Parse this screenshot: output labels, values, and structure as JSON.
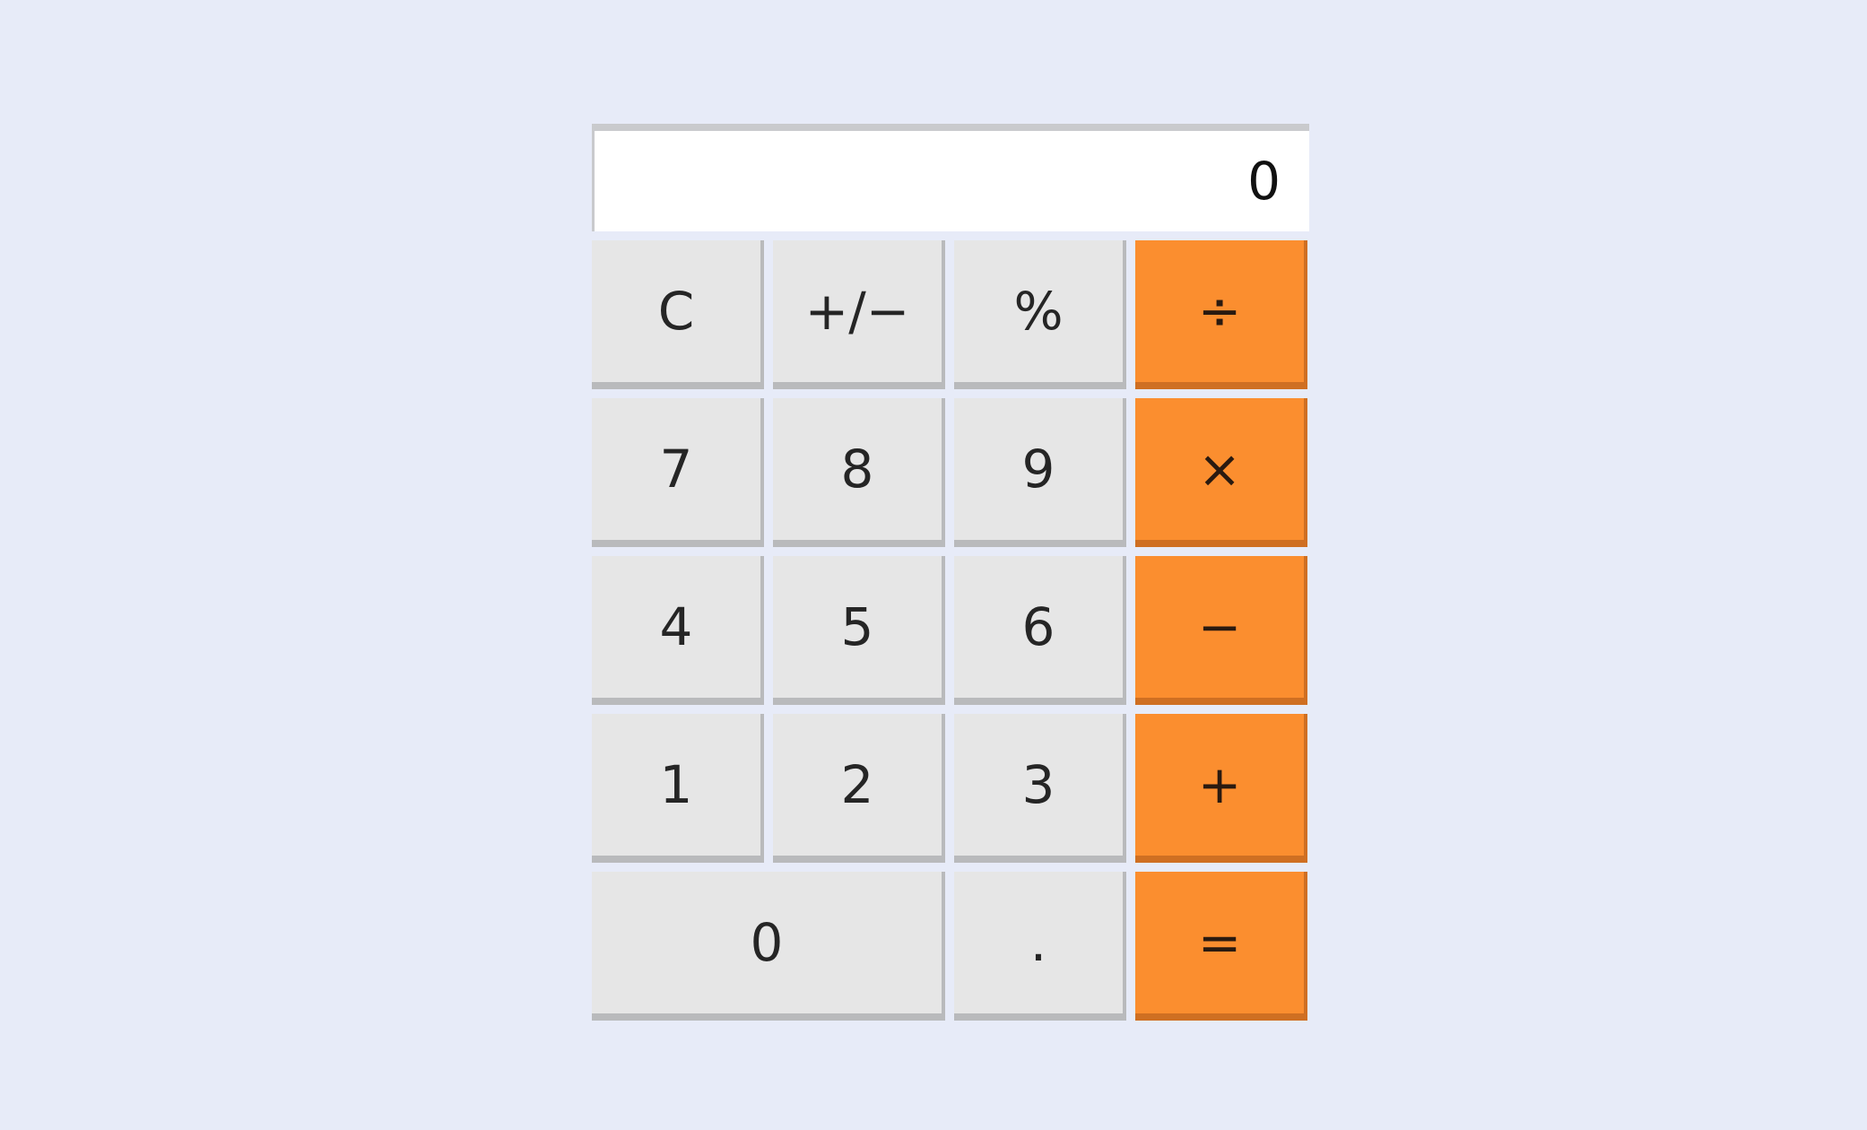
{
  "display": {
    "value": "0"
  },
  "keys": {
    "clear": "C",
    "toggle_sign": "+/−",
    "percent": "%",
    "divide": "÷",
    "seven": "7",
    "eight": "8",
    "nine": "9",
    "multiply": "×",
    "four": "4",
    "five": "5",
    "six": "6",
    "subtract": "−",
    "one": "1",
    "two": "2",
    "three": "3",
    "add": "+",
    "zero": "0",
    "decimal": ".",
    "equals": "="
  },
  "colors": {
    "background": "#e7ebf8",
    "key": "#e6e6e6",
    "operator": "#fb8e2f",
    "display": "#ffffff"
  }
}
